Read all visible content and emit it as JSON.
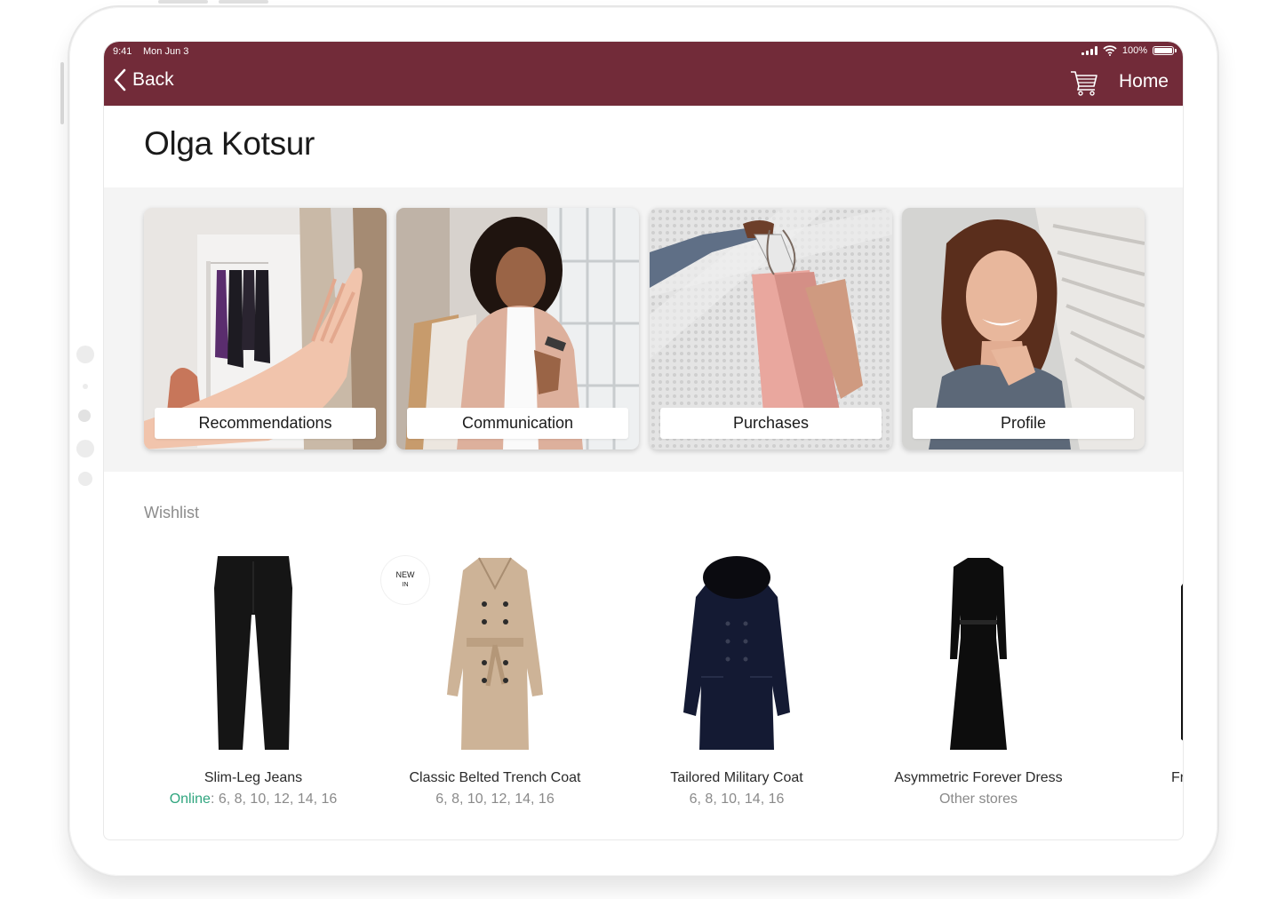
{
  "status_bar": {
    "time": "9:41",
    "date": "Mon Jun 3",
    "battery": "100%",
    "battery_level": 1.0
  },
  "nav": {
    "back_label": "Back",
    "home_label": "Home",
    "cart_icon": "cart-icon",
    "back_icon": "chevron-left-icon"
  },
  "customer": {
    "name": "Olga Kotsur"
  },
  "tiles": [
    {
      "label": "Recommendations"
    },
    {
      "label": "Communication"
    },
    {
      "label": "Purchases"
    },
    {
      "label": "Profile"
    }
  ],
  "wishlist": {
    "title": "Wishlist",
    "products": [
      {
        "name": "Slim-Leg Jeans",
        "availability_prefix": "Online",
        "availability": ": 6, 8, 10, 12, 14, 16"
      },
      {
        "name": "Classic Belted Trench Coat",
        "availability": "6, 8, 10, 12, 14, 16",
        "badge_line1": "NEW",
        "badge_line2": "IN"
      },
      {
        "name": "Tailored Military Coat",
        "availability": "6, 8, 10, 14, 16"
      },
      {
        "name": "Asymmetric Forever Dress",
        "availability": "Other stores"
      },
      {
        "name": "Fr"
      }
    ]
  },
  "colors": {
    "brand": "#722b39",
    "online": "#2fa57e",
    "muted": "#8c8c8c"
  }
}
